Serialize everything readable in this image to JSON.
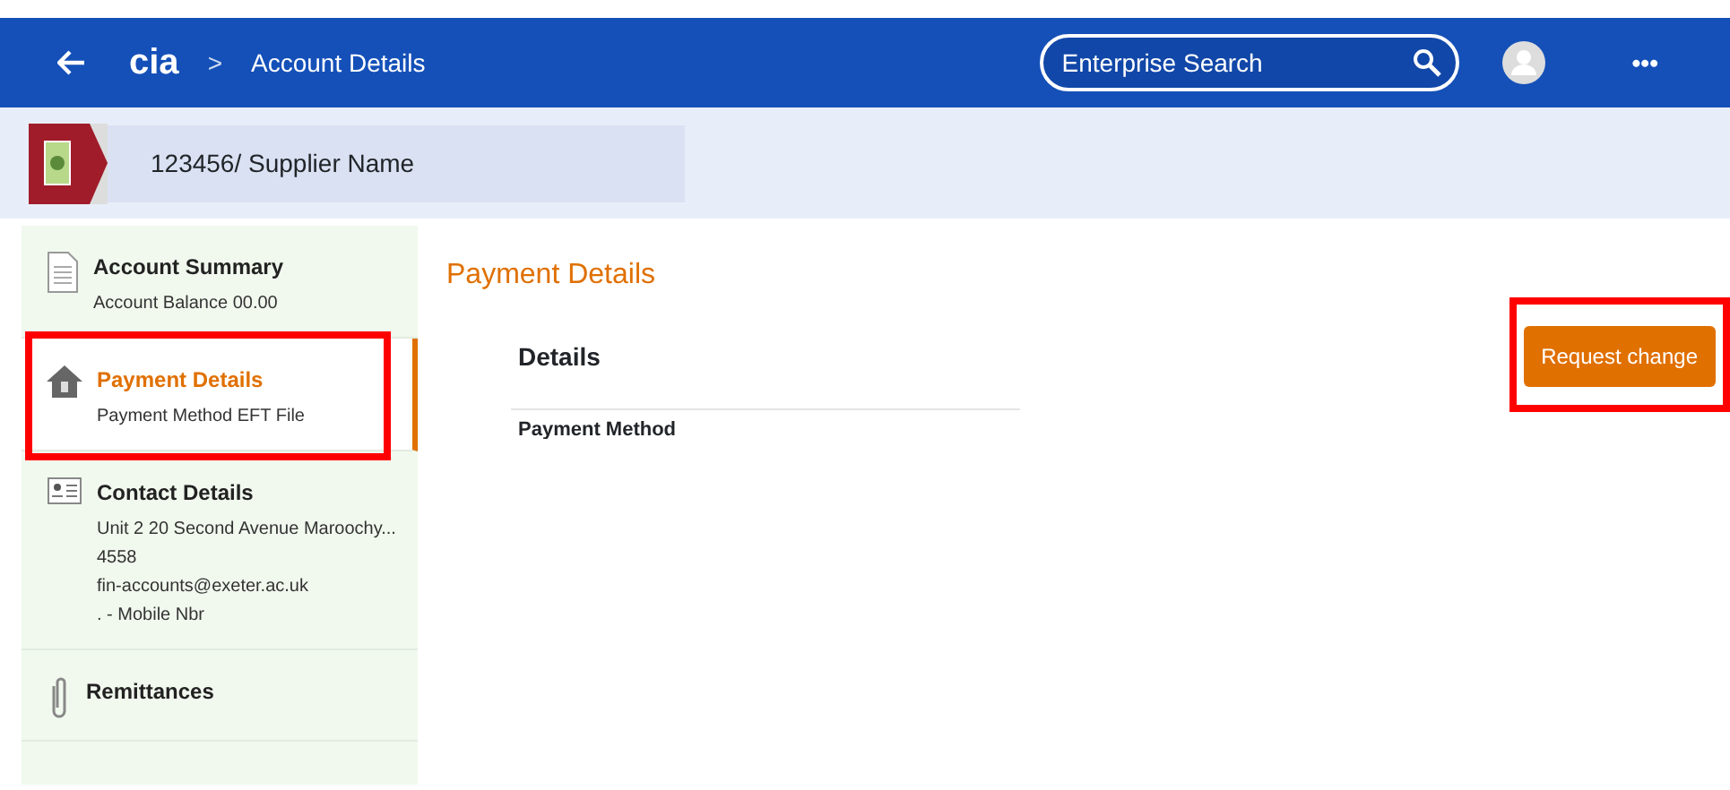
{
  "header": {
    "logo": "cia",
    "breadcrumb_separator": ">",
    "title": "Account Details",
    "search": {
      "placeholder": "Enterprise Search"
    },
    "more": "•••"
  },
  "supplier": {
    "name": "123456/ Supplier Name"
  },
  "sidebar": {
    "items": [
      {
        "kind": "summary",
        "title": "Account Summary",
        "lines": [
          "Account Balance 00.00"
        ],
        "selected": false,
        "highlighted": false
      },
      {
        "kind": "payment",
        "title": "Payment Details",
        "lines": [
          "Payment Method EFT File"
        ],
        "selected": true,
        "highlighted": true
      },
      {
        "kind": "contact",
        "title": "Contact Details",
        "lines": [
          "Unit 2 20 Second Avenue Maroochy...",
          "4558",
          "fin-accounts@exeter.ac.uk",
          ". - Mobile Nbr"
        ],
        "selected": false,
        "highlighted": false
      },
      {
        "kind": "attachment",
        "title": "Remittances",
        "selected": false,
        "highlighted": false
      }
    ]
  },
  "main": {
    "title": "Payment Details",
    "section": "Details",
    "field_label": "Payment Method",
    "button": {
      "label": "Request change",
      "highlighted": true
    }
  }
}
